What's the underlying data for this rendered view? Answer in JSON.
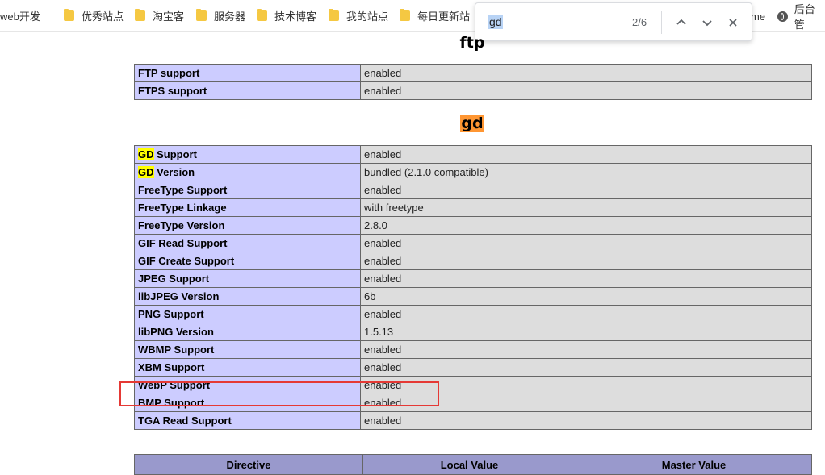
{
  "bookmarks": [
    {
      "label": "web开发",
      "icon": "folder-icon"
    },
    {
      "label": "优秀站点",
      "icon": "folder-icon"
    },
    {
      "label": "淘宝客",
      "icon": "folder-icon"
    },
    {
      "label": "服务器",
      "icon": "folder-icon"
    },
    {
      "label": "技术博客",
      "icon": "folder-icon"
    },
    {
      "label": "我的站点",
      "icon": "folder-icon"
    },
    {
      "label": "每日更新站",
      "icon": "folder-icon"
    }
  ],
  "bookmarks_right": {
    "partial_label": "me",
    "admin_label": "后台管"
  },
  "find_bar": {
    "query": "gd",
    "count": "2/6"
  },
  "ftp": {
    "title": "ftp",
    "rows": [
      {
        "key": "FTP support",
        "value": "enabled"
      },
      {
        "key": "FTPS support",
        "value": "enabled"
      }
    ]
  },
  "gd": {
    "title": "gd",
    "rows": [
      {
        "key_hl": "GD",
        "key_rest": " Support",
        "value": "enabled"
      },
      {
        "key_hl": "GD",
        "key_rest": " Version",
        "value": "bundled (2.1.0 compatible)"
      },
      {
        "key": "FreeType Support",
        "value": "enabled"
      },
      {
        "key": "FreeType Linkage",
        "value": "with freetype"
      },
      {
        "key": "FreeType Version",
        "value": "2.8.0"
      },
      {
        "key": "GIF Read Support",
        "value": "enabled"
      },
      {
        "key": "GIF Create Support",
        "value": "enabled"
      },
      {
        "key": "JPEG Support",
        "value": "enabled"
      },
      {
        "key": "libJPEG Version",
        "value": "6b"
      },
      {
        "key": "PNG Support",
        "value": "enabled"
      },
      {
        "key": "libPNG Version",
        "value": "1.5.13"
      },
      {
        "key": "WBMP Support",
        "value": "enabled"
      },
      {
        "key": "XBM Support",
        "value": "enabled"
      },
      {
        "key": "WebP Support",
        "value": "enabled"
      },
      {
        "key": "BMP Support",
        "value": "enabled"
      },
      {
        "key": "TGA Read Support",
        "value": "enabled"
      }
    ],
    "directive_headers": [
      "Directive",
      "Local Value",
      "Master Value"
    ]
  },
  "colors": {
    "key_cell": "#ccccff",
    "value_cell": "#dddddd",
    "header_cell": "#9999cc",
    "find_active_match": "#ff9632",
    "find_match": "#ffff00",
    "annotation_box": "#e53935"
  }
}
